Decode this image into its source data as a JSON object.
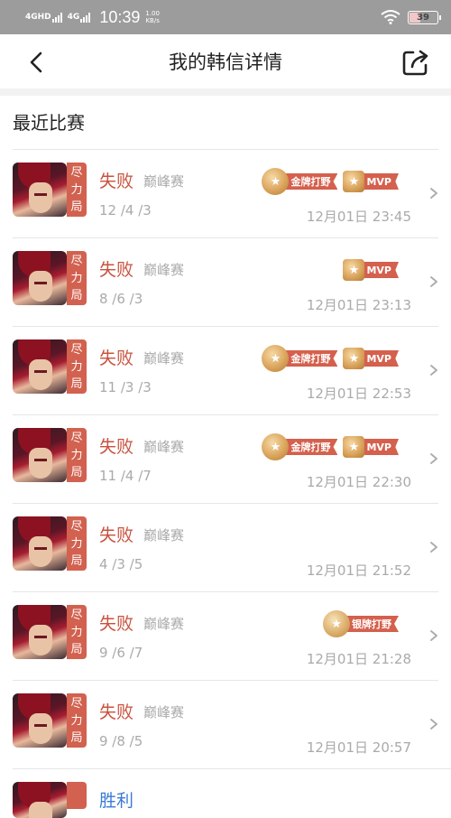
{
  "status_bar": {
    "signal1": "4GHD",
    "signal2": "4G",
    "time": "10:39",
    "speed_value": "1.00",
    "speed_unit": "KB/s",
    "battery": "39"
  },
  "nav": {
    "title": "我的韩信详情"
  },
  "section": {
    "title": "最近比赛"
  },
  "matches": [
    {
      "tag": [
        "尽",
        "力",
        "局"
      ],
      "result": "失败",
      "mode": "巅峰赛",
      "kda": "12 /4 /3",
      "time": "12月01日 23:45",
      "badges": [
        "金牌打野",
        "MVP"
      ]
    },
    {
      "tag": [
        "尽",
        "力",
        "局"
      ],
      "result": "失败",
      "mode": "巅峰赛",
      "kda": "8 /6 /3",
      "time": "12月01日 23:13",
      "badges": [
        "MVP"
      ]
    },
    {
      "tag": [
        "尽",
        "力",
        "局"
      ],
      "result": "失败",
      "mode": "巅峰赛",
      "kda": "11 /3 /3",
      "time": "12月01日 22:53",
      "badges": [
        "金牌打野",
        "MVP"
      ]
    },
    {
      "tag": [
        "尽",
        "力",
        "局"
      ],
      "result": "失败",
      "mode": "巅峰赛",
      "kda": "11 /4 /7",
      "time": "12月01日 22:30",
      "badges": [
        "金牌打野",
        "MVP"
      ]
    },
    {
      "tag": [
        "尽",
        "力",
        "局"
      ],
      "result": "失败",
      "mode": "巅峰赛",
      "kda": "4 /3 /5",
      "time": "12月01日 21:52",
      "badges": []
    },
    {
      "tag": [
        "尽",
        "力",
        "局"
      ],
      "result": "失败",
      "mode": "巅峰赛",
      "kda": "9 /6 /7",
      "time": "12月01日 21:28",
      "badges": [
        "银牌打野"
      ]
    },
    {
      "tag": [
        "尽",
        "力",
        "局"
      ],
      "result": "失败",
      "mode": "巅峰赛",
      "kda": "9 /8 /5",
      "time": "12月01日 20:57",
      "badges": []
    }
  ],
  "partial_match": {
    "result": "胜利"
  }
}
